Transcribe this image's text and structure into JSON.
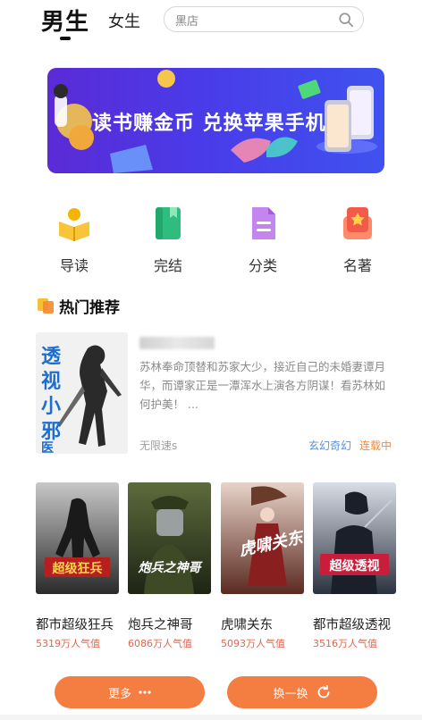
{
  "header": {
    "tab_male": "男生",
    "tab_female": "女生",
    "search_placeholder": "黑店"
  },
  "banner": {
    "text": "读书赚金币 兑换苹果手机"
  },
  "categories": [
    {
      "label": "导读",
      "icon": "reader-icon",
      "color": "#f5b400"
    },
    {
      "label": "完结",
      "icon": "book-icon",
      "color": "#2ebd7e"
    },
    {
      "label": "分类",
      "icon": "document-icon",
      "color": "#b46be3"
    },
    {
      "label": "名著",
      "icon": "award-book-icon",
      "color": "#f35a4a"
    }
  ],
  "hot": {
    "title": "热门推荐",
    "featured": {
      "cover_title": "透视小邪医",
      "description": "苏林奉命顶替和苏家大少，接近自己的未婚妻谭月华，而谭家正是一潭浑水上演各方阴谋！看苏林如何护美！ ...",
      "author": "无限速s",
      "genre": "玄幻奇幻",
      "status": "连载中"
    },
    "books": [
      {
        "title": "都市超级狂兵",
        "popularity": "5319万人气值",
        "cover_text": "超级狂兵"
      },
      {
        "title": "炮兵之神哥",
        "popularity": "6086万人气值",
        "cover_text": "炮兵之神哥"
      },
      {
        "title": "虎啸关东",
        "popularity": "5093万人气值",
        "cover_text": "虎啸关东"
      },
      {
        "title": "都市超级透视",
        "popularity": "3516万人气值",
        "cover_text": "超级透视"
      }
    ]
  },
  "actions": {
    "more": "更多",
    "refresh": "换一换"
  },
  "colors": {
    "accent": "#f47d42",
    "banner": "#4a3be8",
    "genre": "#5a8fd6",
    "status": "#f08a3c",
    "popularity": "#e0664f"
  }
}
